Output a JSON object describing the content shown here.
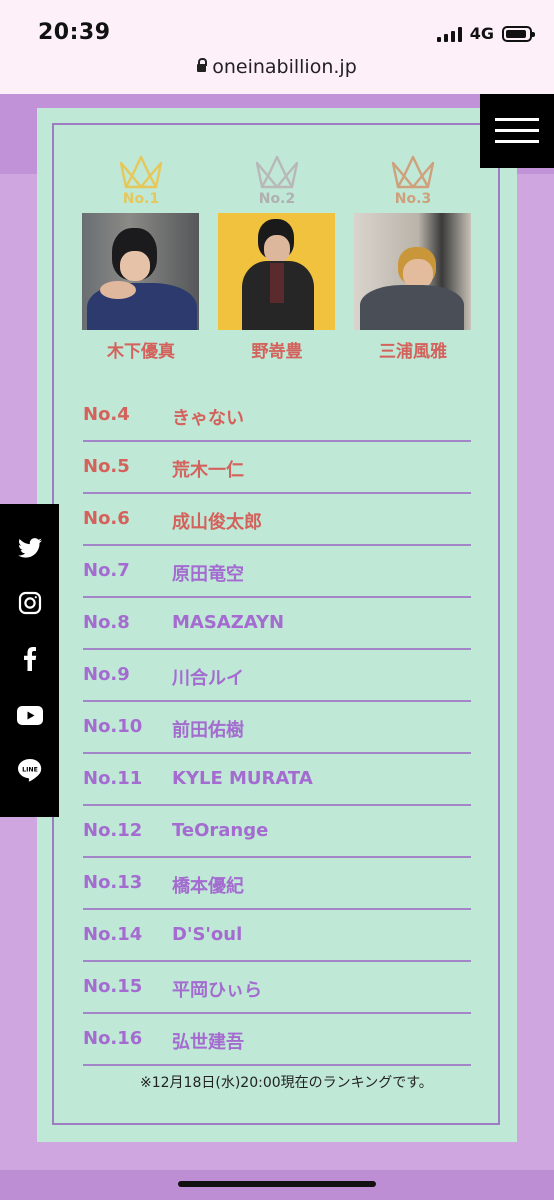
{
  "status": {
    "time": "20:39",
    "network": "4G"
  },
  "browser": {
    "url": "oneinabillion.jp"
  },
  "top3": [
    {
      "no": "No.1",
      "name": "木下優真",
      "crown_color": "#e6c85a"
    },
    {
      "no": "No.2",
      "name": "野嵜豊",
      "crown_color": "#b8b8b8"
    },
    {
      "no": "No.3",
      "name": "三浦風雅",
      "crown_color": "#cfa07c"
    }
  ],
  "ranking": [
    {
      "no": "No.4",
      "name": "きゃない"
    },
    {
      "no": "No.5",
      "name": "荒木一仁"
    },
    {
      "no": "No.6",
      "name": "成山俊太郎"
    },
    {
      "no": "No.7",
      "name": "原田竜空"
    },
    {
      "no": "No.8",
      "name": "MASAZAYN"
    },
    {
      "no": "No.9",
      "name": "川合ルイ"
    },
    {
      "no": "No.10",
      "name": "前田佑樹"
    },
    {
      "no": "No.11",
      "name": "KYLE MURATA"
    },
    {
      "no": "No.12",
      "name": "TeOrange"
    },
    {
      "no": "No.13",
      "name": "橋本優紀"
    },
    {
      "no": "No.14",
      "name": "D'S'oul"
    },
    {
      "no": "No.15",
      "name": "平岡ひぃら"
    },
    {
      "no": "No.16",
      "name": "弘世建吾"
    }
  ],
  "note": "※12月18日(水)20:00現在のランキングです。",
  "social": [
    "twitter-icon",
    "instagram-icon",
    "facebook-icon",
    "youtube-icon",
    "line-icon"
  ],
  "colors": {
    "highlight": "#d4625c",
    "normal": "#a46bd0",
    "no1": "#e6c85a",
    "no2": "#b8b8b8",
    "no3": "#cfa07c"
  }
}
